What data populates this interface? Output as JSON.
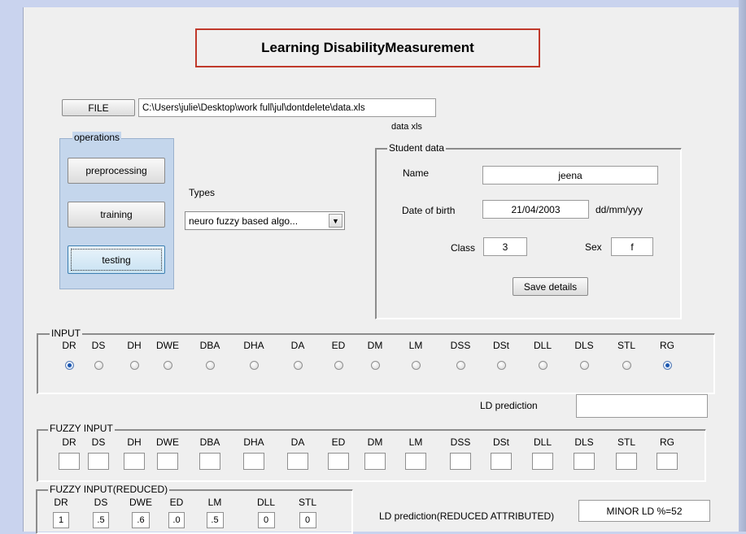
{
  "title": "Learning DisabilityMeasurement",
  "file": {
    "button_label": "FILE",
    "path": "C:\\Users\\julie\\Desktop\\work full\\jul\\dontdelete\\data.xls",
    "caption": "data xls"
  },
  "operations": {
    "title": "operations",
    "buttons": [
      "preprocessing",
      "training",
      "testing"
    ],
    "focused": "testing"
  },
  "types": {
    "label": "Types",
    "selected": "neuro fuzzy based algo..."
  },
  "student": {
    "title": "Student data",
    "name_label": "Name",
    "name_value": "jeena",
    "dob_label": "Date of birth",
    "dob_value": "21/04/2003",
    "dob_format": "dd/mm/yyy",
    "class_label": "Class",
    "class_value": "3",
    "sex_label": "Sex",
    "sex_value": "f",
    "save_label": "Save details"
  },
  "input": {
    "title": "INPUT",
    "labels": [
      "DR",
      "DS",
      "DH",
      "DWE",
      "DBA",
      "DHA",
      "DA",
      "ED",
      "DM",
      "LM",
      "DSS",
      "DSt",
      "DLL",
      "DLS",
      "STL",
      "RG"
    ],
    "selected": [
      "DR",
      "RG"
    ]
  },
  "ld_prediction": {
    "label": "LD prediction",
    "value": ""
  },
  "fuzzy_input": {
    "title": "FUZZY INPUT",
    "labels": [
      "DR",
      "DS",
      "DH",
      "DWE",
      "DBA",
      "DHA",
      "DA",
      "ED",
      "DM",
      "LM",
      "DSS",
      "DSt",
      "DLL",
      "DLS",
      "STL",
      "RG"
    ]
  },
  "fuzzy_reduced": {
    "title": "FUZZY INPUT(REDUCED)",
    "labels": [
      "DR",
      "DS",
      "DWE",
      "ED",
      "LM",
      "DLL",
      "STL"
    ],
    "values": [
      "1",
      ".5",
      ".6",
      ".0",
      ".5",
      "0",
      "0"
    ]
  },
  "ld_reduced": {
    "label": "LD prediction(REDUCED ATTRIBUTED)",
    "value": "MINOR  LD %=52"
  },
  "icons": {
    "dropdown": "chevron-down-icon",
    "radio": "radio-button"
  }
}
